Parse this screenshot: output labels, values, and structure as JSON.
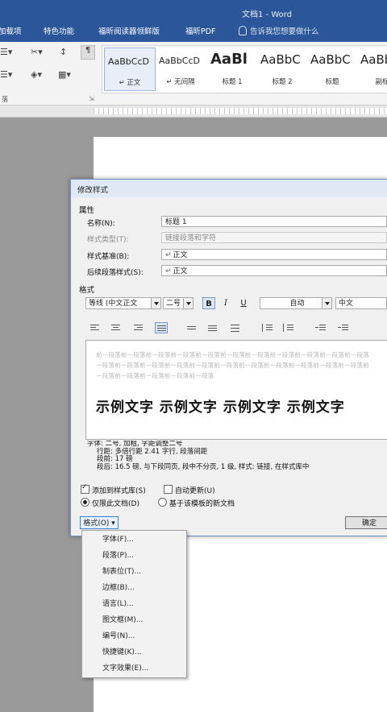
{
  "window": {
    "title": "文档1 - Word"
  },
  "ribbon_tabs": [
    "加载项",
    "特色功能",
    "福昕阅读器领鲜版",
    "福昕PDF"
  ],
  "tell_me": "告诉我您想要做什么",
  "ribbon_group_label": "落",
  "styles": [
    {
      "sample": "AaBbCcD",
      "name": "正文",
      "selected": true
    },
    {
      "sample": "AaBbCcD",
      "name": "无间隔",
      "selected": false
    },
    {
      "sample": "AaBl",
      "name": "标题 1",
      "selected": false
    },
    {
      "sample": "AaBbC",
      "name": "标题 2",
      "selected": false
    },
    {
      "sample": "AaBbC",
      "name": "标题",
      "selected": false
    },
    {
      "sample": "AaBb",
      "name": "副标",
      "selected": false
    }
  ],
  "dialog": {
    "title": "修改样式",
    "properties_heading": "属性",
    "name_label": "名称(N):",
    "name_value": "标题 1",
    "type_label": "样式类型(T):",
    "type_value": "链接段落和字符",
    "based_label": "样式基准(B):",
    "based_value": "正文",
    "following_label": "后续段落样式(S):",
    "following_value": "正文",
    "format_heading": "格式",
    "font": "等线 (中文正文",
    "size": "二号",
    "bold_label": "B",
    "italic_label": "I",
    "underline_label": "U",
    "color": "自动",
    "script": "中文",
    "preview_prev_lines": [
      "前一段落前一段落前一段落前一段落前一段落前一段落前一段落前一段落前一段落前一段落前一段落",
      "一段落前一段落前一段落前一段落前一段落前一段落前一段落前一段落前一段落前一段落前一段落前",
      "一段落前一段落前一段落前一段落前一段落"
    ],
    "preview_sample": "示例文字 示例文字 示例文字 示例文字",
    "description_lines": [
      "字体: 二号, 加粗, 字距调整二号",
      "行距: 多倍行距 2.41 字行, 段落间距",
      "段前: 17 磅",
      "段后: 16.5 磅, 与下段同页, 段中不分页, 1 级, 样式: 链接, 在样式库中"
    ],
    "add_to_gallery": "添加到样式库(S)",
    "auto_update": "自动更新(U)",
    "only_this_doc": "仅限此文档(D)",
    "new_docs_template": "基于该模板的新文档",
    "format_button": "格式(O)",
    "ok_button": "确定"
  },
  "format_menu": [
    "字体(F)...",
    "段落(P)...",
    "制表位(T)...",
    "边框(B)...",
    "语言(L)...",
    "图文框(M)...",
    "编号(N)...",
    "快捷键(K)...",
    "文字效果(E)..."
  ]
}
